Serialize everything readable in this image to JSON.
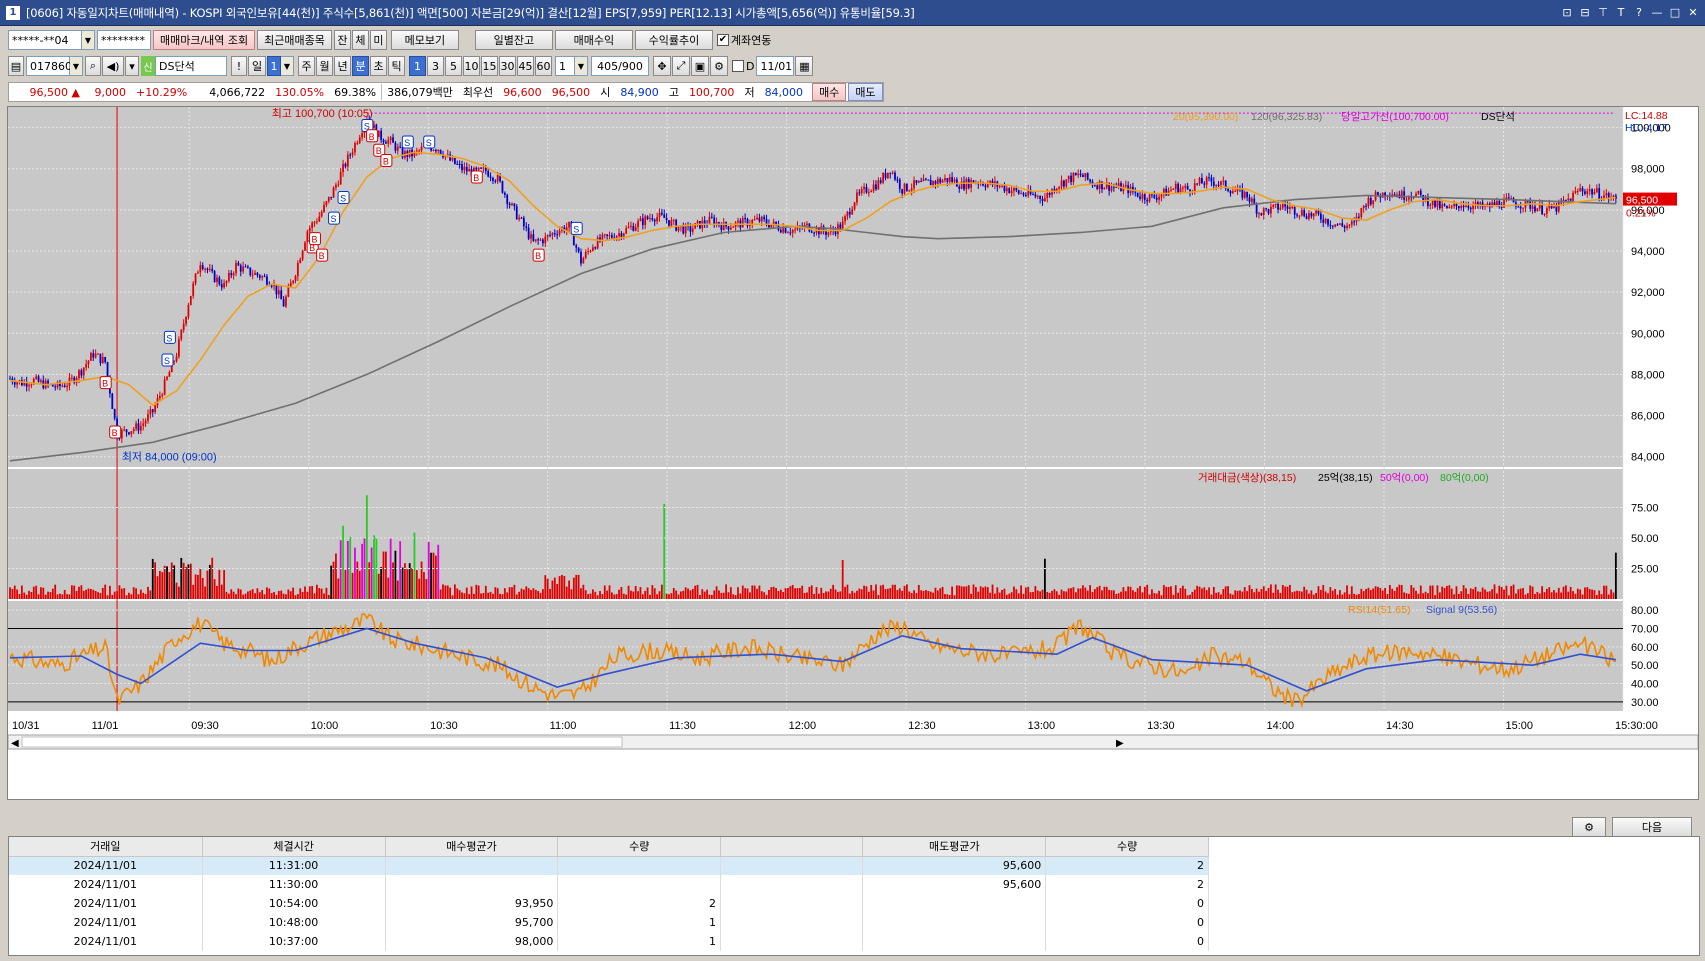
{
  "window": {
    "title": "[0606] 자동일지차트(매매내역) - KOSPI 외국인보유[44(천)] 주식수[5,861(천)] 액면[500] 자본금[29(억)] 결산[12월] EPS[7,959] PER[12.13] 시가총액[5,656(억)] 유통비율[59.3]",
    "app_number": "1",
    "buttons": [
      "⊡",
      "⊟",
      "⊤",
      "T",
      "?",
      "—",
      "□",
      "✕"
    ]
  },
  "toolbar1": {
    "account": "*****-**04",
    "password": "********",
    "buttons": [
      "매매마크/내역 조회",
      "최근매매종목",
      "잔",
      "체",
      "미",
      "메모보기",
      "일별잔고",
      "매매수익",
      "수익률추이"
    ],
    "checkbox_label": "계좌연동",
    "checkbox_checked": true
  },
  "toolbar2": {
    "code": "017860",
    "credit_badge": "신",
    "stock_name": "DS단석",
    "icon_buttons": [
      "!",
      "일"
    ],
    "count_value": "1",
    "periods": [
      "주",
      "월",
      "년",
      "분",
      "초",
      "틱"
    ],
    "period_selected": "분",
    "intervals": [
      "1",
      "3",
      "5",
      "10",
      "15",
      "30",
      "45",
      "60"
    ],
    "interval_selected": "1",
    "multi": "1",
    "pages": "405/900",
    "checkbox_d_label": "D",
    "date": "11/01"
  },
  "quote": {
    "price": "96,500",
    "arrow": "▲",
    "change": "9,000",
    "change_rate": "+10.29%",
    "volume": "4,066,722",
    "vol_ratio": "130.05%",
    "rate2": "69.38%",
    "amount": "386,079백만",
    "best_label": "최우선",
    "best_ask": "96,600",
    "best_bid": "96,500",
    "open_label": "시",
    "open": "84,900",
    "high_label": "고",
    "high": "100,700",
    "low_label": "저",
    "low": "84,000",
    "buy_btn": "매수",
    "sell_btn": "매도"
  },
  "chart_data": {
    "type": "candlestick",
    "symbol": "DS단석",
    "interval": "1분",
    "price_axis": [
      "100,000",
      "98,000",
      "96,000",
      "94,000",
      "92,000",
      "90,000",
      "88,000",
      "86,000",
      "84,000"
    ],
    "ylim": [
      83500,
      101000
    ],
    "time_axis": [
      "10/31",
      "11/01",
      "09:30",
      "10:00",
      "10:30",
      "11:00",
      "11:30",
      "12:00",
      "12:30",
      "13:00",
      "13:30",
      "14:00",
      "14:30",
      "15:00",
      "15:30:00"
    ],
    "series_legend": [
      "20(95,390.00)",
      "120(96,325.83)",
      "당일고가선(100,700.00)",
      "DS단석"
    ],
    "lc": "LC:14.88",
    "hc": "HC:-4.17",
    "current_price_tag": "96,500",
    "current_rate_tag": "0.21%",
    "high_annotation": "최고 100,700 (10:05)",
    "low_annotation": "최저 84,000 (09:00)",
    "close_path": [
      [
        0,
        87800
      ],
      [
        5,
        87600
      ],
      [
        10,
        87700
      ],
      [
        15,
        87500
      ],
      [
        20,
        87400
      ],
      [
        25,
        87600
      ],
      [
        30,
        88200
      ],
      [
        35,
        89000
      ],
      [
        40,
        88600
      ],
      [
        45,
        85100
      ],
      [
        50,
        85300
      ],
      [
        55,
        85500
      ],
      [
        60,
        86200
      ],
      [
        65,
        87500
      ],
      [
        70,
        89000
      ],
      [
        75,
        91500
      ],
      [
        80,
        93500
      ],
      [
        85,
        92800
      ],
      [
        90,
        92300
      ],
      [
        95,
        93300
      ],
      [
        100,
        93000
      ],
      [
        105,
        92800
      ],
      [
        110,
        92500
      ],
      [
        115,
        91400
      ],
      [
        120,
        93000
      ],
      [
        125,
        95000
      ],
      [
        130,
        95700
      ],
      [
        135,
        96700
      ],
      [
        140,
        98000
      ],
      [
        145,
        99200
      ],
      [
        150,
        100500
      ],
      [
        155,
        99600
      ],
      [
        160,
        99300
      ],
      [
        165,
        98700
      ],
      [
        170,
        98700
      ],
      [
        175,
        99100
      ],
      [
        180,
        99000
      ],
      [
        185,
        98400
      ],
      [
        190,
        98000
      ],
      [
        195,
        97800
      ],
      [
        200,
        97900
      ],
      [
        205,
        97500
      ],
      [
        210,
        96300
      ],
      [
        215,
        95400
      ],
      [
        220,
        94400
      ],
      [
        225,
        94600
      ],
      [
        230,
        95000
      ],
      [
        235,
        95200
      ],
      [
        240,
        93500
      ],
      [
        245,
        94300
      ],
      [
        250,
        94600
      ],
      [
        255,
        94800
      ],
      [
        260,
        95100
      ],
      [
        265,
        95400
      ],
      [
        270,
        95700
      ],
      [
        275,
        95600
      ],
      [
        280,
        95200
      ],
      [
        285,
        95000
      ],
      [
        290,
        95300
      ],
      [
        295,
        95500
      ],
      [
        300,
        95200
      ],
      [
        305,
        95300
      ],
      [
        310,
        95400
      ],
      [
        315,
        95500
      ],
      [
        320,
        95300
      ],
      [
        325,
        95100
      ],
      [
        330,
        95000
      ],
      [
        335,
        95200
      ],
      [
        340,
        95000
      ],
      [
        345,
        94900
      ],
      [
        350,
        95300
      ],
      [
        355,
        96500
      ],
      [
        360,
        97000
      ],
      [
        365,
        97300
      ],
      [
        370,
        98000
      ],
      [
        375,
        97000
      ],
      [
        380,
        97200
      ],
      [
        385,
        97300
      ],
      [
        390,
        97400
      ],
      [
        395,
        97500
      ],
      [
        400,
        97200
      ],
      [
        405,
        97400
      ],
      [
        410,
        97300
      ],
      [
        415,
        97200
      ],
      [
        420,
        97000
      ],
      [
        425,
        96800
      ],
      [
        430,
        96700
      ],
      [
        435,
        96600
      ],
      [
        440,
        97200
      ],
      [
        445,
        97500
      ],
      [
        450,
        97700
      ],
      [
        455,
        97300
      ],
      [
        460,
        97200
      ],
      [
        465,
        97100
      ],
      [
        470,
        97000
      ],
      [
        475,
        96700
      ],
      [
        480,
        96600
      ],
      [
        485,
        96800
      ],
      [
        490,
        97100
      ],
      [
        495,
        97000
      ],
      [
        500,
        97300
      ],
      [
        505,
        97400
      ],
      [
        510,
        97200
      ],
      [
        515,
        96900
      ],
      [
        520,
        96700
      ],
      [
        525,
        95900
      ],
      [
        530,
        96000
      ],
      [
        535,
        96200
      ],
      [
        540,
        96000
      ],
      [
        545,
        95800
      ],
      [
        550,
        95700
      ],
      [
        555,
        95400
      ],
      [
        560,
        95200
      ],
      [
        565,
        95300
      ],
      [
        570,
        96400
      ],
      [
        575,
        96700
      ],
      [
        580,
        96900
      ],
      [
        585,
        96700
      ],
      [
        590,
        96800
      ],
      [
        595,
        96500
      ],
      [
        600,
        96200
      ],
      [
        605,
        96000
      ],
      [
        610,
        96300
      ],
      [
        615,
        96200
      ],
      [
        620,
        96100
      ],
      [
        625,
        96300
      ],
      [
        630,
        96400
      ],
      [
        635,
        96300
      ],
      [
        640,
        96200
      ],
      [
        645,
        96000
      ],
      [
        650,
        96100
      ],
      [
        655,
        96500
      ],
      [
        660,
        97000
      ],
      [
        665,
        96900
      ],
      [
        670,
        96700
      ],
      [
        675,
        96500
      ]
    ],
    "ma20_path": [
      [
        0,
        87700
      ],
      [
        15,
        87500
      ],
      [
        30,
        87700
      ],
      [
        40,
        87900
      ],
      [
        50,
        87500
      ],
      [
        60,
        86500
      ],
      [
        70,
        87200
      ],
      [
        80,
        88700
      ],
      [
        90,
        90400
      ],
      [
        100,
        91800
      ],
      [
        110,
        92400
      ],
      [
        120,
        92200
      ],
      [
        130,
        93700
      ],
      [
        140,
        95900
      ],
      [
        150,
        97600
      ],
      [
        160,
        98500
      ],
      [
        170,
        98800
      ],
      [
        180,
        98700
      ],
      [
        190,
        98500
      ],
      [
        200,
        98100
      ],
      [
        210,
        97400
      ],
      [
        220,
        96200
      ],
      [
        230,
        95200
      ],
      [
        240,
        94600
      ],
      [
        250,
        94500
      ],
      [
        260,
        94700
      ],
      [
        270,
        95000
      ],
      [
        280,
        95200
      ],
      [
        290,
        95300
      ],
      [
        300,
        95300
      ],
      [
        310,
        95300
      ],
      [
        320,
        95300
      ],
      [
        330,
        95200
      ],
      [
        340,
        95000
      ],
      [
        350,
        95000
      ],
      [
        360,
        95600
      ],
      [
        370,
        96400
      ],
      [
        380,
        96900
      ],
      [
        390,
        97200
      ],
      [
        400,
        97300
      ],
      [
        410,
        97300
      ],
      [
        420,
        97200
      ],
      [
        430,
        96900
      ],
      [
        440,
        96900
      ],
      [
        450,
        97200
      ],
      [
        460,
        97300
      ],
      [
        470,
        97000
      ],
      [
        480,
        96800
      ],
      [
        490,
        96800
      ],
      [
        500,
        96900
      ],
      [
        510,
        97100
      ],
      [
        520,
        97000
      ],
      [
        530,
        96500
      ],
      [
        540,
        96200
      ],
      [
        550,
        96000
      ],
      [
        560,
        95600
      ],
      [
        570,
        95500
      ],
      [
        580,
        96000
      ],
      [
        590,
        96400
      ],
      [
        600,
        96500
      ],
      [
        610,
        96300
      ],
      [
        620,
        96200
      ],
      [
        630,
        96200
      ],
      [
        640,
        96300
      ],
      [
        650,
        96200
      ],
      [
        660,
        96400
      ],
      [
        675,
        96600
      ]
    ],
    "ma120_path": [
      [
        0,
        83800
      ],
      [
        30,
        84200
      ],
      [
        60,
        84700
      ],
      [
        90,
        85600
      ],
      [
        120,
        86600
      ],
      [
        150,
        88000
      ],
      [
        180,
        89600
      ],
      [
        210,
        91300
      ],
      [
        240,
        92900
      ],
      [
        270,
        94100
      ],
      [
        300,
        94900
      ],
      [
        330,
        95200
      ],
      [
        345,
        95100
      ],
      [
        360,
        94900
      ],
      [
        375,
        94700
      ],
      [
        390,
        94600
      ],
      [
        420,
        94700
      ],
      [
        450,
        94900
      ],
      [
        480,
        95200
      ],
      [
        510,
        96100
      ],
      [
        540,
        96500
      ],
      [
        570,
        96700
      ],
      [
        600,
        96600
      ],
      [
        630,
        96500
      ],
      [
        675,
        96300
      ]
    ],
    "volume_panel": {
      "legend": [
        "거래대금(색상)(38,15)",
        "25억(38,15)",
        "50억(0,00)",
        "80억(0,00)"
      ],
      "axis": [
        "75.00",
        "50.00",
        "25.00"
      ]
    },
    "rsi_panel": {
      "legend": [
        "RSI14(51.65)",
        "Signal 9(53.56)"
      ],
      "axis": [
        "80.00",
        "70.00",
        "60.00",
        "50.00",
        "40.00",
        "30.00"
      ],
      "rsi_path": [
        [
          0,
          55
        ],
        [
          20,
          50
        ],
        [
          40,
          60
        ],
        [
          45,
          30
        ],
        [
          55,
          40
        ],
        [
          70,
          65
        ],
        [
          80,
          73
        ],
        [
          90,
          62
        ],
        [
          100,
          58
        ],
        [
          110,
          52
        ],
        [
          120,
          60
        ],
        [
          135,
          68
        ],
        [
          145,
          72
        ],
        [
          150,
          75
        ],
        [
          160,
          64
        ],
        [
          175,
          60
        ],
        [
          190,
          55
        ],
        [
          205,
          50
        ],
        [
          220,
          38
        ],
        [
          230,
          33
        ],
        [
          240,
          35
        ],
        [
          255,
          55
        ],
        [
          270,
          58
        ],
        [
          290,
          54
        ],
        [
          310,
          60
        ],
        [
          330,
          54
        ],
        [
          350,
          50
        ],
        [
          365,
          68
        ],
        [
          375,
          72
        ],
        [
          385,
          62
        ],
        [
          400,
          58
        ],
        [
          420,
          55
        ],
        [
          440,
          60
        ],
        [
          450,
          72
        ],
        [
          465,
          55
        ],
        [
          480,
          50
        ],
        [
          495,
          45
        ],
        [
          505,
          55
        ],
        [
          520,
          52
        ],
        [
          530,
          38
        ],
        [
          540,
          30
        ],
        [
          555,
          45
        ],
        [
          570,
          55
        ],
        [
          590,
          58
        ],
        [
          610,
          52
        ],
        [
          630,
          48
        ],
        [
          645,
          55
        ],
        [
          660,
          62
        ],
        [
          675,
          52
        ]
      ],
      "signal_path": [
        [
          0,
          54
        ],
        [
          30,
          55
        ],
        [
          45,
          45
        ],
        [
          55,
          40
        ],
        [
          80,
          62
        ],
        [
          100,
          58
        ],
        [
          120,
          58
        ],
        [
          150,
          70
        ],
        [
          170,
          62
        ],
        [
          200,
          54
        ],
        [
          230,
          38
        ],
        [
          250,
          45
        ],
        [
          280,
          54
        ],
        [
          320,
          56
        ],
        [
          350,
          52
        ],
        [
          375,
          66
        ],
        [
          400,
          59
        ],
        [
          440,
          56
        ],
        [
          455,
          65
        ],
        [
          480,
          53
        ],
        [
          520,
          50
        ],
        [
          545,
          36
        ],
        [
          570,
          48
        ],
        [
          600,
          53
        ],
        [
          640,
          50
        ],
        [
          660,
          56
        ],
        [
          675,
          53
        ]
      ]
    }
  },
  "trades_table": {
    "headers": [
      "거래일",
      "체결시간",
      "매수평균가",
      "수량",
      "",
      "매도평균가",
      "수량"
    ],
    "rows": [
      {
        "date": "2024/11/01",
        "time": "11:31:00",
        "buy_avg": "",
        "buy_qty": "",
        "sell_avg": "95,600",
        "sell_qty": "2"
      },
      {
        "date": "2024/11/01",
        "time": "11:30:00",
        "buy_avg": "",
        "buy_qty": "",
        "sell_avg": "95,600",
        "sell_qty": "2"
      },
      {
        "date": "2024/11/01",
        "time": "10:54:00",
        "buy_avg": "93,950",
        "buy_qty": "2",
        "sell_avg": "",
        "sell_qty": "0"
      },
      {
        "date": "2024/11/01",
        "time": "10:48:00",
        "buy_avg": "95,700",
        "buy_qty": "1",
        "sell_avg": "",
        "sell_qty": "0"
      },
      {
        "date": "2024/11/01",
        "time": "10:37:00",
        "buy_avg": "98,000",
        "buy_qty": "1",
        "sell_avg": "",
        "sell_qty": "0"
      }
    ],
    "next_button": "다음"
  },
  "colors": {
    "up": "#e00000",
    "down": "#0000cc",
    "ma20": "#f0a020",
    "ma120": "#707070",
    "highline": "#e000e0",
    "rsi": "#f08800",
    "signal": "#3050d0"
  }
}
